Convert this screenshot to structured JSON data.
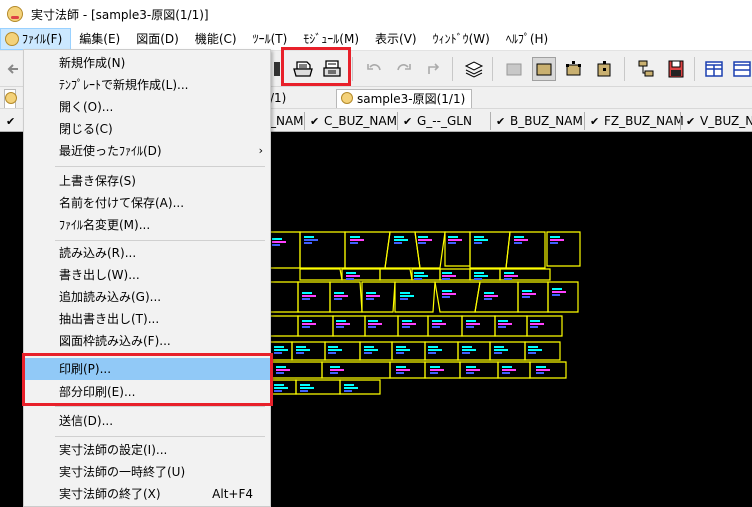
{
  "window": {
    "title": "実寸法師 - [sample3-原図(1/1)]"
  },
  "menubar": {
    "items": [
      {
        "label": "ﾌｧｲﾙ(F)"
      },
      {
        "label": "編集(E)"
      },
      {
        "label": "図面(D)"
      },
      {
        "label": "機能(C)"
      },
      {
        "label": "ﾂｰﾙ(T)"
      },
      {
        "label": "ﾓｼﾞｭｰﾙ(M)"
      },
      {
        "label": "表示(V)"
      },
      {
        "label": "ｳｨﾝﾄﾞｳ(W)"
      },
      {
        "label": "ﾍﾙﾌﾟ(H)"
      }
    ]
  },
  "tabs": {
    "partial_label": "/1)",
    "active_label": "sample3-原図(1/1)"
  },
  "layers": {
    "items": [
      {
        "label": "_NAM",
        "checked": false
      },
      {
        "label": "C_BUZ_NAM",
        "checked": true
      },
      {
        "label": "G_--_GLN",
        "checked": true
      },
      {
        "label": "B_BUZ_NAM",
        "checked": true
      },
      {
        "label": "FZ_BUZ_NAM",
        "checked": true
      },
      {
        "label": "V_BUZ_NAM",
        "checked": true
      }
    ]
  },
  "file_menu": {
    "items": [
      {
        "label": "新規作成(N)"
      },
      {
        "label": "ﾃﾝﾌﾟﾚｰﾄで新規作成(L)..."
      },
      {
        "label": "開く(O)..."
      },
      {
        "label": "閉じる(C)"
      },
      {
        "label": "最近使ったﾌｧｲﾙ(D)",
        "submenu_arrow": "›"
      },
      {
        "label": "上書き保存(S)"
      },
      {
        "label": "名前を付けて保存(A)..."
      },
      {
        "label": "ﾌｧｲﾙ名変更(M)..."
      },
      {
        "label": "読み込み(R)..."
      },
      {
        "label": "書き出し(W)..."
      },
      {
        "label": "追加読み込み(G)..."
      },
      {
        "label": "抽出書き出し(T)..."
      },
      {
        "label": "図面枠読み込み(F)..."
      },
      {
        "label": "印刷(P)...",
        "highlighted": true
      },
      {
        "label": "部分印刷(E)..."
      },
      {
        "label": "送信(D)..."
      },
      {
        "label": "実寸法師の設定(I)..."
      },
      {
        "label": "実寸法師の一時終了(U)"
      },
      {
        "label": "実寸法師の終了(X)",
        "shortcut": "Alt+F4"
      }
    ]
  },
  "colors": {
    "canvas_bg": "#000000",
    "pattern_outline": "#ffff00",
    "label_cyan": "#00ffff",
    "label_magenta": "#ff40ff",
    "label_blue": "#4060ff",
    "menu_highlight": "#91c9f7",
    "annotation_red": "#e8202a"
  }
}
